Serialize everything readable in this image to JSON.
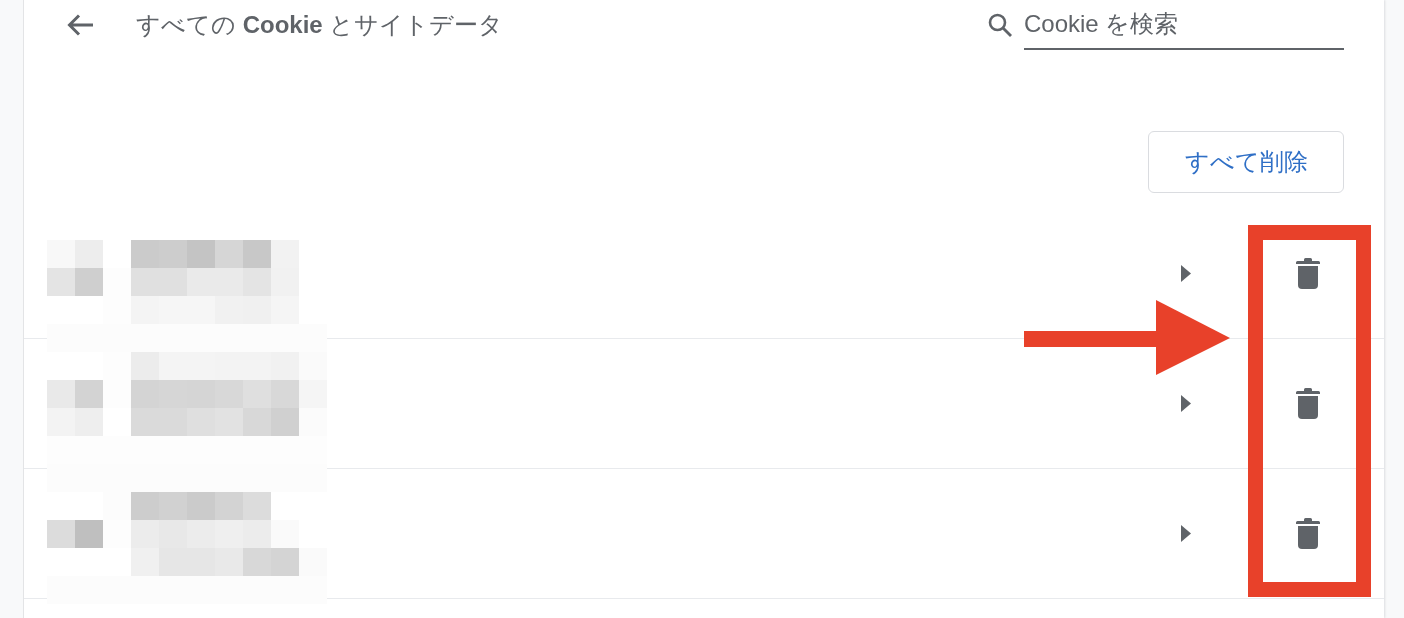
{
  "header": {
    "title": "すべての **Cookie** とサイトデータ",
    "search": {
      "placeholder": "Cookie を検索"
    }
  },
  "actions": {
    "remove_all_button": "すべて削除"
  },
  "rows": [
    {
      "expanded": false
    },
    {
      "expanded": false
    },
    {
      "expanded": false
    }
  ],
  "annotations": {
    "arrow": true,
    "highlight_frame": true
  }
}
